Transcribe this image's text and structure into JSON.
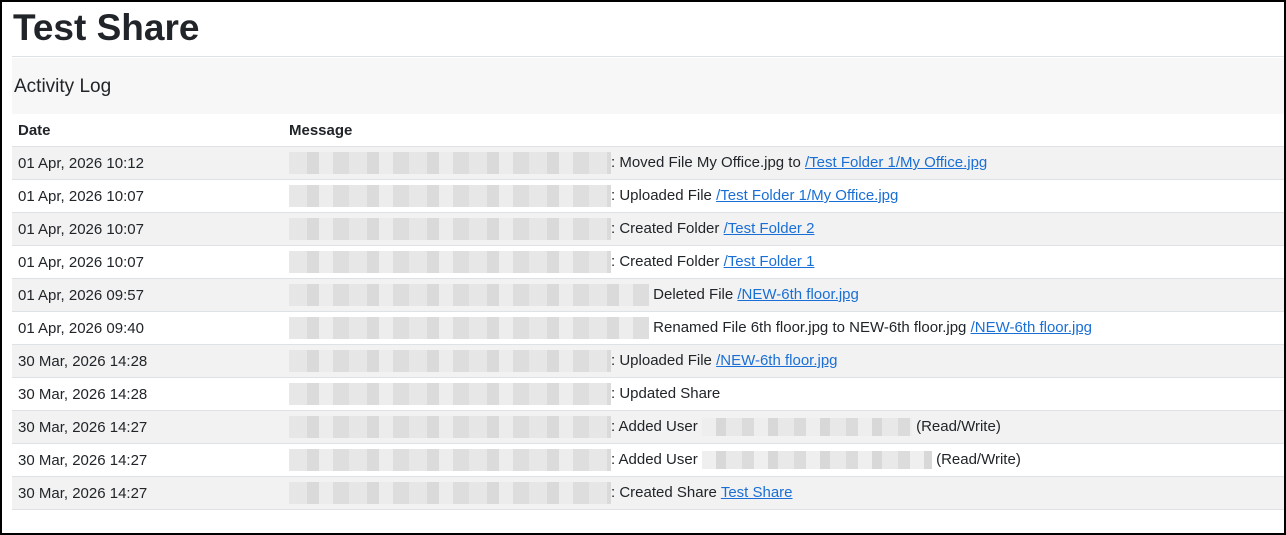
{
  "page": {
    "title": "Test Share"
  },
  "section": {
    "title": "Activity Log"
  },
  "table": {
    "headers": {
      "date": "Date",
      "message": "Message"
    },
    "rows": [
      {
        "date": "01 Apr, 2026 10:12",
        "prefix": ": ",
        "text": "Moved File My Office.jpg to ",
        "link": "/Test Folder 1/My Office.jpg",
        "user": "",
        "suffix": ""
      },
      {
        "date": "01 Apr, 2026 10:07",
        "prefix": ": ",
        "text": "Uploaded File ",
        "link": "/Test Folder 1/My Office.jpg",
        "user": "",
        "suffix": ""
      },
      {
        "date": "01 Apr, 2026 10:07",
        "prefix": ": ",
        "text": "Created Folder ",
        "link": "/Test Folder 2",
        "user": "",
        "suffix": ""
      },
      {
        "date": "01 Apr, 2026 10:07",
        "prefix": ": ",
        "text": "Created Folder ",
        "link": "/Test Folder 1",
        "user": "",
        "suffix": ""
      },
      {
        "date": "01 Apr, 2026 09:57",
        "prefix": " ",
        "text": "Deleted File ",
        "link": "/NEW-6th floor.jpg",
        "user": "",
        "suffix": ""
      },
      {
        "date": "01 Apr, 2026 09:40",
        "prefix": " ",
        "text": "Renamed File 6th floor.jpg to NEW-6th floor.jpg ",
        "link": "/NEW-6th floor.jpg",
        "user": "",
        "suffix": ""
      },
      {
        "date": "30 Mar, 2026 14:28",
        "prefix": ": ",
        "text": "Uploaded File ",
        "link": "/NEW-6th floor.jpg",
        "user": "",
        "suffix": ""
      },
      {
        "date": "30 Mar, 2026 14:28",
        "prefix": ": ",
        "text": "Updated Share",
        "link": "",
        "user": "",
        "suffix": ""
      },
      {
        "date": "30 Mar, 2026 14:27",
        "prefix": ": ",
        "text": "Added User ",
        "link": "",
        "user": "redacted",
        "suffix": " (Read/Write)"
      },
      {
        "date": "30 Mar, 2026 14:27",
        "prefix": ": ",
        "text": "Added User ",
        "link": "",
        "user": "redacted",
        "suffix": " (Read/Write)"
      },
      {
        "date": "30 Mar, 2026 14:27",
        "prefix": ": ",
        "text": "Created Share ",
        "link": "Test Share",
        "user": "",
        "suffix": ""
      }
    ]
  }
}
